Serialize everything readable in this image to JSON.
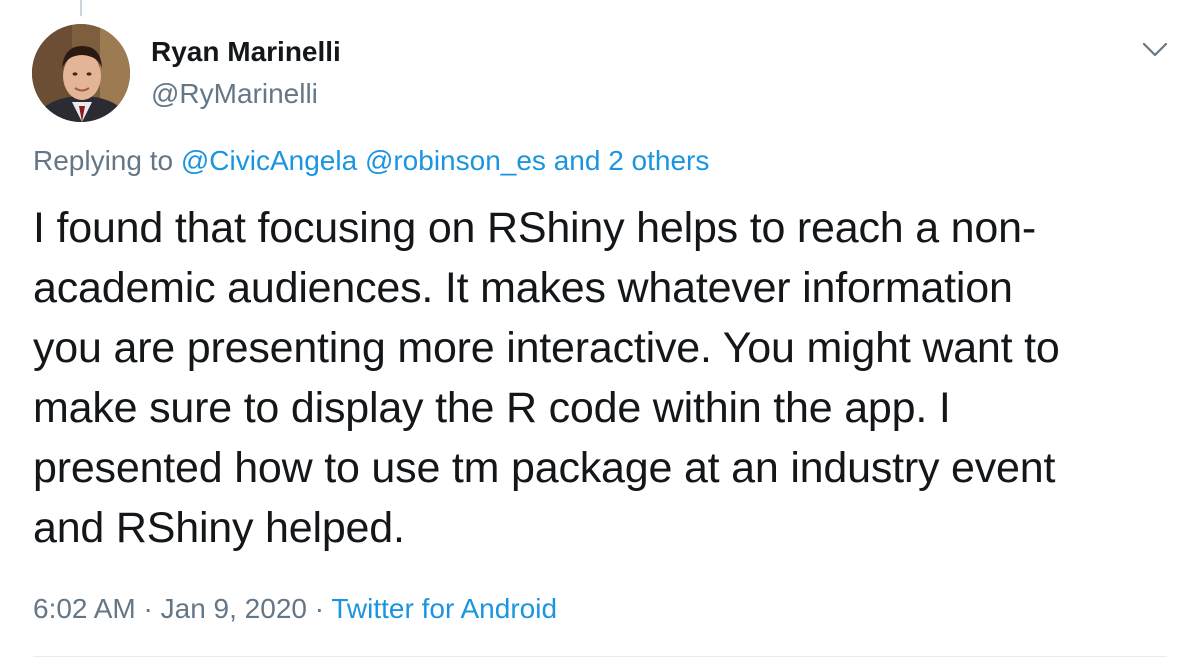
{
  "tweet": {
    "author": {
      "name": "Ryan Marinelli",
      "handle": "@RyMarinelli"
    },
    "replying": {
      "prefix": "Replying to",
      "mention1": "@CivicAngela",
      "mention2": "@robinson_es",
      "others": "and 2 others"
    },
    "text_lines": [
      "I found that focusing on RShiny helps to reach a non-",
      "academic audiences. It makes whatever information",
      "you are presenting more interactive. You might want to",
      "make sure to display the R code within the app. I",
      "presented how to use tm package at an industry event",
      "and RShiny helped."
    ],
    "meta": {
      "time": "6:02 AM",
      "separator": "·",
      "date": "Jan 9, 2020",
      "source": "Twitter for Android"
    }
  },
  "icons": {
    "more_menu": "chevron-down-icon",
    "avatar": "profile-photo"
  },
  "colors": {
    "text_primary": "#14171a",
    "text_secondary": "#657786",
    "link": "#1b95e0",
    "divider": "#e6ecf0"
  }
}
